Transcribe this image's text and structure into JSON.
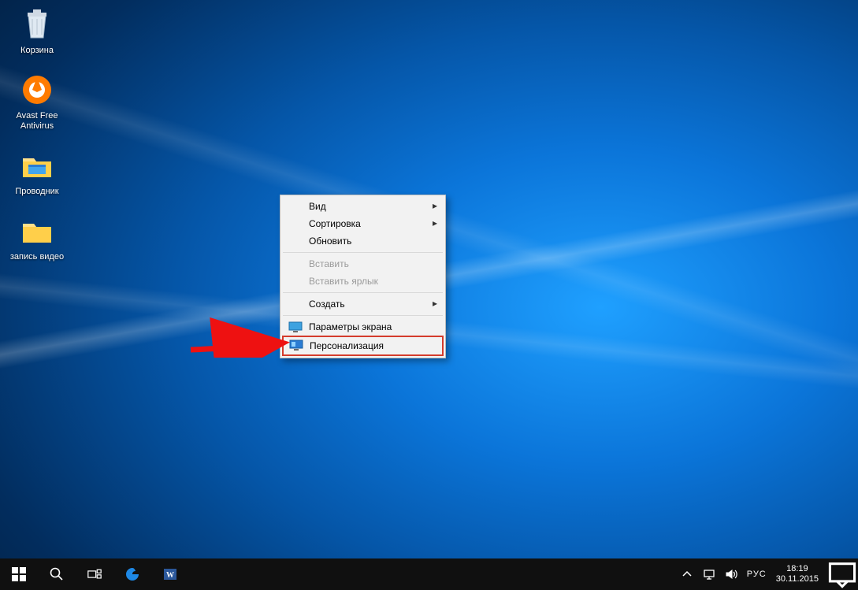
{
  "desktop_icons": [
    {
      "id": "recycle-bin",
      "label": "Корзина"
    },
    {
      "id": "avast",
      "label": "Avast Free Antivirus"
    },
    {
      "id": "explorer",
      "label": "Проводник"
    },
    {
      "id": "video-rec",
      "label": "запись видео"
    }
  ],
  "context_menu": {
    "view": "Вид",
    "sort": "Сортировка",
    "refresh": "Обновить",
    "paste": "Вставить",
    "paste_shortcut": "Вставить ярлык",
    "create": "Создать",
    "display": "Параметры экрана",
    "personalize": "Персонализация"
  },
  "taskbar": {
    "lang": "РУС",
    "time": "18:19",
    "date": "30.11.2015"
  }
}
